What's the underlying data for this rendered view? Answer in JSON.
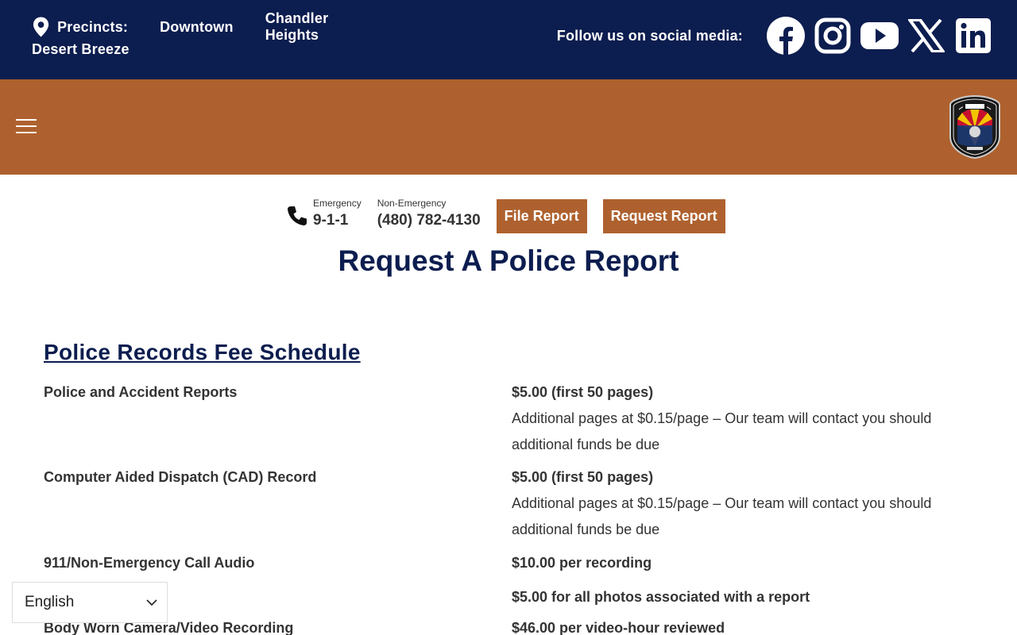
{
  "topbar": {
    "precincts_label": "Precincts:",
    "precincts": [
      "Downtown",
      "Chandler Heights",
      "Desert Breeze"
    ],
    "follow_text": "Follow us on social media:",
    "social_icons": [
      "facebook-icon",
      "instagram-icon",
      "youtube-icon",
      "x-icon",
      "linkedin-icon"
    ]
  },
  "contact": {
    "emergency_label": "Emergency",
    "emergency_number": "9-1-1",
    "non_emergency_label": "Non-Emergency",
    "non_emergency_number": "(480) 782-4130",
    "file_report": "File Report",
    "request_report": "Request Report"
  },
  "page_title": "Request A Police Report",
  "fee_schedule": {
    "heading": "Police Records Fee Schedule",
    "rows": [
      {
        "item": "Police and Accident Reports",
        "amount": "$5.00 (first 50 pages)",
        "note": "Additional pages at $0.15/page – Our team will contact you should additional funds be due"
      },
      {
        "item": "Computer Aided Dispatch (CAD) Record",
        "amount": "$5.00 (first 50 pages)",
        "note": "Additional pages at $0.15/page – Our team will contact you should additional funds be due"
      },
      {
        "item": "911/Non-Emergency Call Audio",
        "amount": "$10.00 per recording",
        "note": ""
      },
      {
        "item": "",
        "amount": "$5.00 for all photos associated with a report",
        "note": ""
      },
      {
        "item": "Body Worn Camera/Video Recording",
        "amount": "$46.00 per video-hour reviewed",
        "note": ""
      }
    ]
  },
  "language": {
    "selected": "English"
  },
  "colors": {
    "navy": "#0c1d4f",
    "orange": "#ae612e"
  }
}
